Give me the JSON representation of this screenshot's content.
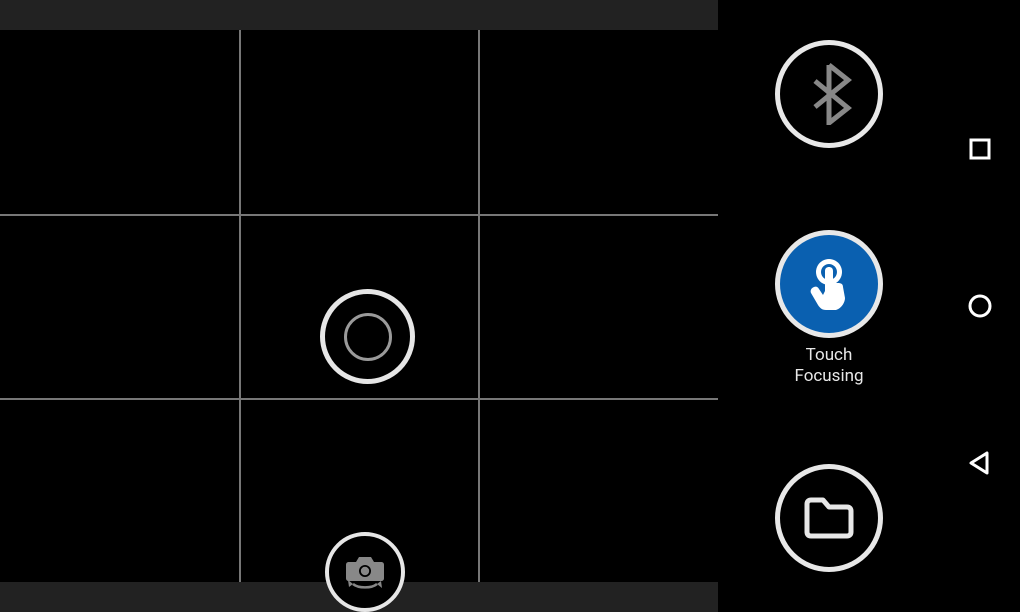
{
  "controls": {
    "bluetooth_icon": "bluetooth",
    "touch_focus_icon": "touch",
    "touch_focus_label": "Touch\nFocusing",
    "files_icon": "folder",
    "switch_camera_icon": "switch-camera"
  },
  "navbar": {
    "back_icon": "back",
    "home_icon": "home",
    "recent_icon": "recent"
  },
  "colors": {
    "accent": "#0a60b0",
    "outline": "#e8e8e8",
    "grid": "#777777"
  }
}
